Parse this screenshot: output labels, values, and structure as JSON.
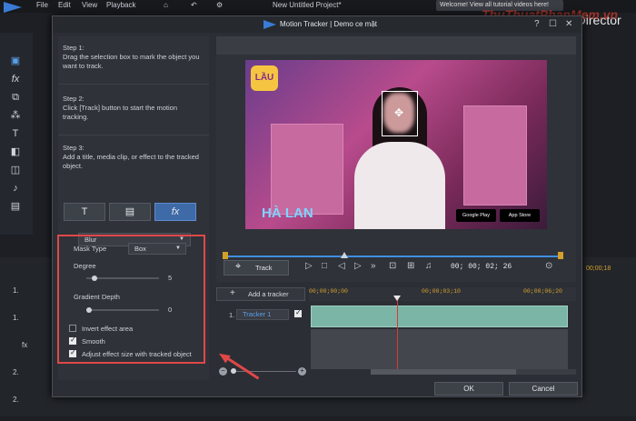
{
  "app": {
    "title": "New Untitled Project*",
    "menu": [
      "File",
      "Edit",
      "View",
      "Playback"
    ],
    "brand": "rDirector",
    "notification": "Welcome! View all tutorial videos here!",
    "watermark": "ThuThuatPhanMem.vn"
  },
  "timeline": {
    "tracks": [
      {
        "label": "1."
      },
      {
        "label": "1."
      },
      {
        "label": "fx"
      },
      {
        "label": "2."
      },
      {
        "label": "2."
      }
    ],
    "ruler_right": "00;00;18"
  },
  "dialog": {
    "title": "Motion Tracker | Demo ce mật",
    "controls": [
      "?",
      "☐",
      "✕"
    ],
    "steps": [
      {
        "heading": "Step 1:",
        "text": "Drag the selection box to mark the object you want to track."
      },
      {
        "heading": "Step 2:",
        "text": "Click [Track] button to start the motion tracking."
      },
      {
        "heading": "Step 3:",
        "text": "Add a title, media clip, or effect to the tracked object."
      }
    ],
    "type_buttons": [
      {
        "label": "T",
        "icon": "title-icon"
      },
      {
        "label": "▤",
        "icon": "media-icon"
      },
      {
        "label": "fx",
        "icon": "fx-icon"
      }
    ],
    "effect": "Blur",
    "settings": {
      "mask_type_label": "Mask Type",
      "mask_type_value": "Box",
      "degree_label": "Degree",
      "degree_value": "5",
      "degree_level": 0.08,
      "gradient_label": "Gradient Depth",
      "gradient_value": "0",
      "gradient_level": 0.0,
      "invert_label": "Invert effect area",
      "invert_checked": false,
      "smooth_label": "Smooth",
      "smooth_checked": true,
      "adjust_label": "Adjust effect size with tracked object",
      "adjust_checked": true
    },
    "video": {
      "badge": "LẦU",
      "logo_text": "HÀ LAN",
      "store1": "Google Play",
      "store2": "App Store"
    },
    "controls_bar": {
      "track_label": "Track",
      "timecode": "00; 00; 02; 26"
    },
    "tracker": {
      "add_label": "Add a tracker",
      "ruler": [
        "00;00;00;00",
        "00;00;03;10",
        "00;00;06;20"
      ],
      "row_index": "1.",
      "row_name": "Tracker 1",
      "row_checked": true
    },
    "footer": {
      "ok": "OK",
      "cancel": "Cancel"
    }
  }
}
